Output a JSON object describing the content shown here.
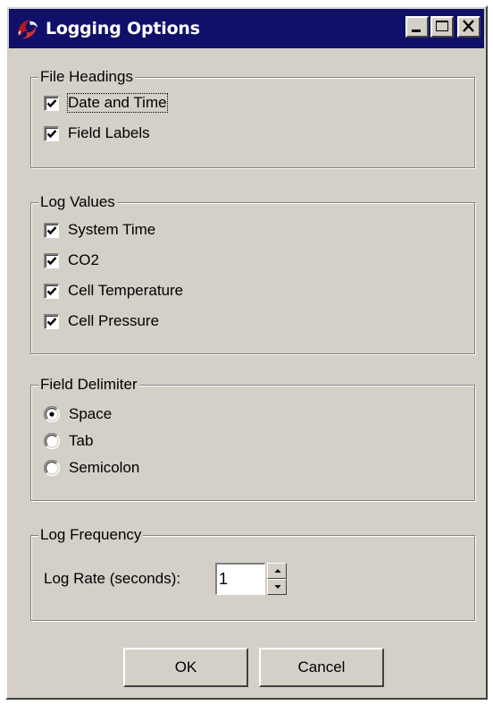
{
  "window": {
    "title": "Logging Options",
    "icon": "red-swirl-app-icon",
    "controls": [
      "minimize-icon",
      "maximize-icon",
      "close-icon"
    ]
  },
  "file_headings": {
    "label": "File Headings",
    "items": [
      {
        "label": "Date and Time",
        "checked": true
      },
      {
        "label": "Field Labels",
        "checked": true
      }
    ]
  },
  "log_values": {
    "label": "Log Values",
    "items": [
      {
        "label": "System Time",
        "checked": true
      },
      {
        "label": "CO2",
        "checked": true
      },
      {
        "label": "Cell Temperature",
        "checked": true
      },
      {
        "label": "Cell Pressure",
        "checked": true
      }
    ]
  },
  "field_delimiter": {
    "label": "Field Delimiter",
    "options": [
      {
        "label": "Space",
        "selected": true
      },
      {
        "label": "Tab",
        "selected": false
      },
      {
        "label": "Semicolon",
        "selected": false
      }
    ]
  },
  "log_frequency": {
    "label": "Log Frequency",
    "rate_label": "Log Rate (seconds):",
    "rate_value": "1"
  },
  "buttons": {
    "ok": "OK",
    "cancel": "Cancel"
  },
  "colors": {
    "titlebar": "#10106b",
    "face": "#d4d0c8",
    "icon_red": "#cc2020"
  }
}
